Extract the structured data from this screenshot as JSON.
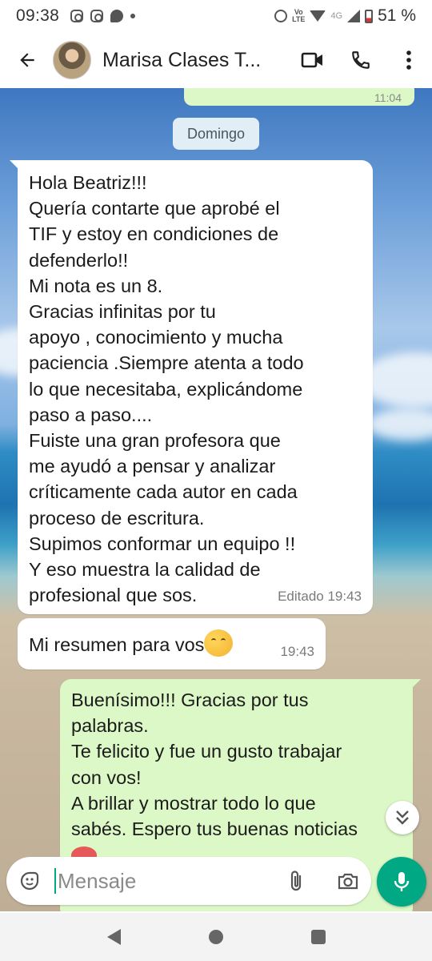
{
  "status_bar": {
    "time": "09:38",
    "volte_label_1": "Vo",
    "volte_label_2": "LTE",
    "network": "4G",
    "battery": "51 %"
  },
  "header": {
    "contact_name": "Marisa Clases T...",
    "icons": [
      "back-arrow-icon",
      "video-call-icon",
      "phone-icon",
      "more-options-icon"
    ]
  },
  "chat": {
    "prev_time": "11:04",
    "date_chip": "Domingo",
    "messages": [
      {
        "direction": "incoming",
        "lines": [
          "Hola Beatriz!!!",
          "Quería contarte que aprobé el",
          "TIF y estoy en condiciones de",
          "defenderlo!!",
          "Mi nota es un 8.",
          "Gracias infinitas por tu",
          "apoyo ,  conocimiento y mucha",
          "paciencia .Siempre atenta a todo",
          "lo que necesitaba, explicándome",
          "paso a paso....",
          "Fuiste una gran profesora que",
          "me ayudó a pensar y analizar",
          "críticamente cada autor en cada",
          "proceso de escritura.",
          "Supimos  conformar un equipo !!",
          "Y eso muestra la calidad de",
          "profesional que sos."
        ],
        "time": "Editado 19:43"
      },
      {
        "direction": "incoming",
        "text": "Mi resumen para vos",
        "emoji": "hugging-face-emoji",
        "time": "19:43"
      },
      {
        "direction": "outgoing",
        "lines": [
          "Buenísimo!!! Gracias por tus",
          "palabras.",
          "Te felicito y fue un gusto trabajar",
          "con vos!",
          "A brillar y mostrar todo lo que",
          "sabés. Espero tus buenas noticias"
        ],
        "emoji": "heart-emoji"
      }
    ]
  },
  "input": {
    "placeholder": "Mensaje",
    "icons": [
      "emoji-sticker-icon",
      "attach-icon",
      "camera-icon",
      "mic-icon"
    ]
  },
  "colors": {
    "accent": "#00a884",
    "outgoing_bubble": "#dcf8c6",
    "incoming_bubble": "#ffffff",
    "date_chip": "#e1eef6"
  }
}
